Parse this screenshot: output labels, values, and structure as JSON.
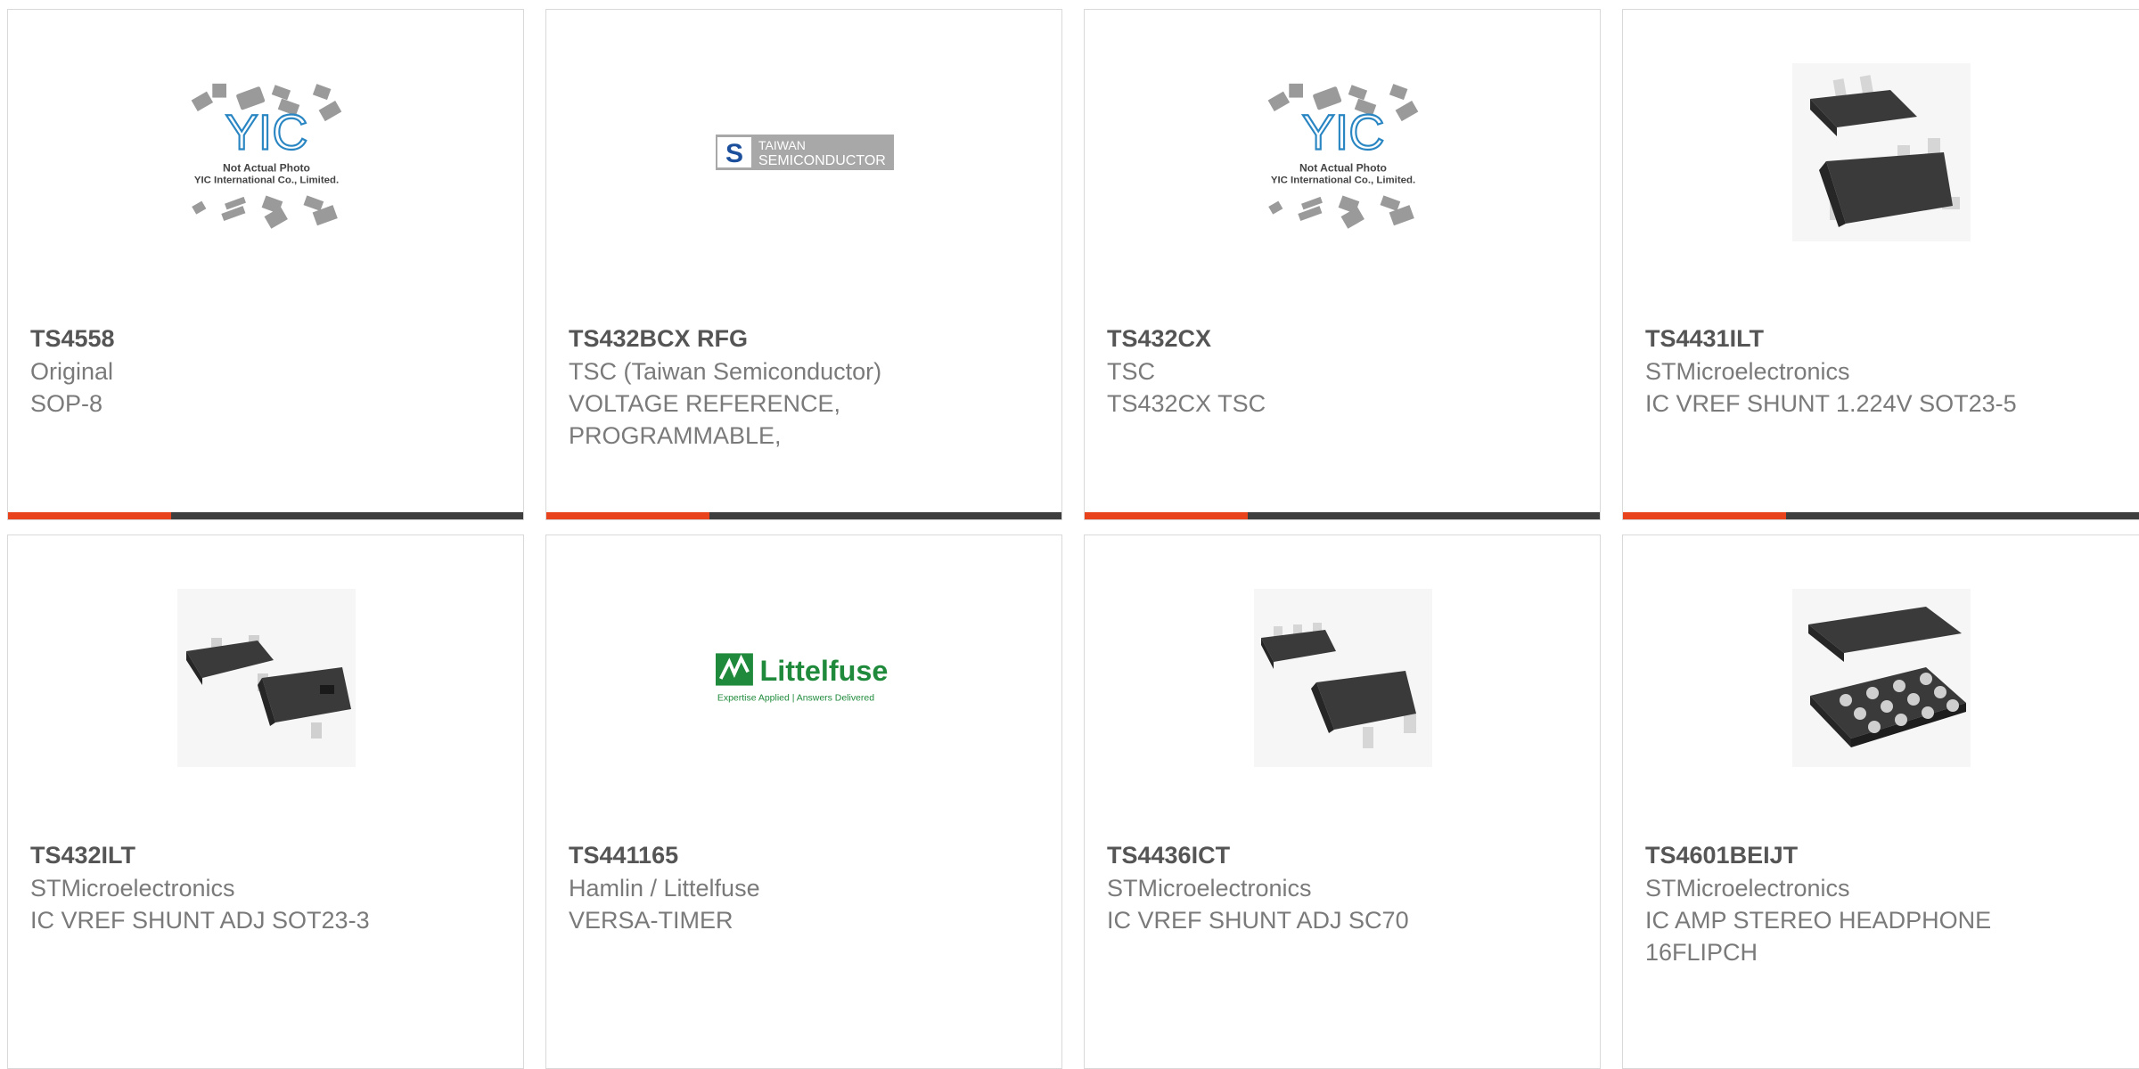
{
  "colors": {
    "accent": "#e8431d",
    "bar": "#3e3e3e",
    "border": "#d9d9d9",
    "title": "#555555",
    "text": "#7a7a7a"
  },
  "products": [
    {
      "part_number": "TS4558",
      "manufacturer": "Original",
      "description": "SOP-8",
      "image": "yic-placeholder-image",
      "image_text": {
        "logo": "YIC",
        "line1": "Not Actual Photo",
        "line2": "YIC International Co., Limited."
      }
    },
    {
      "part_number": "TS432BCX RFG",
      "manufacturer": "TSC (Taiwan Semiconductor)",
      "description": "VOLTAGE REFERENCE, PROGRAMMABLE,",
      "image": "taiwan-semiconductor-logo",
      "image_text": {
        "line1": "TAIWAN",
        "line2": "SEMICONDUCTOR"
      }
    },
    {
      "part_number": "TS432CX",
      "manufacturer": "TSC",
      "description": "TS432CX TSC",
      "image": "yic-placeholder-image",
      "image_text": {
        "logo": "YIC",
        "line1": "Not Actual Photo",
        "line2": "YIC International Co., Limited."
      }
    },
    {
      "part_number": "TS4431ILT",
      "manufacturer": "STMicroelectronics",
      "description": "IC VREF SHUNT 1.224V SOT23-5",
      "image": "sot23-5-chip-photo"
    },
    {
      "part_number": "TS432ILT",
      "manufacturer": "STMicroelectronics",
      "description": "IC VREF SHUNT ADJ SOT23-3",
      "image": "sot23-3-chip-photo"
    },
    {
      "part_number": "TS441165",
      "manufacturer": "Hamlin / Littelfuse",
      "description": "VERSA-TIMER",
      "image": "littelfuse-logo",
      "image_text": {
        "brand": "Littelfuse",
        "tagline": "Expertise Applied | Answers Delivered"
      }
    },
    {
      "part_number": "TS4436ICT",
      "manufacturer": "STMicroelectronics",
      "description": "IC VREF SHUNT ADJ SC70",
      "image": "sc70-chip-photo"
    },
    {
      "part_number": "TS4601BEIJT",
      "manufacturer": "STMicroelectronics",
      "description": "IC AMP STEREO HEADPHONE 16FLIPCH",
      "image": "flip-chip-bga-photo"
    }
  ]
}
